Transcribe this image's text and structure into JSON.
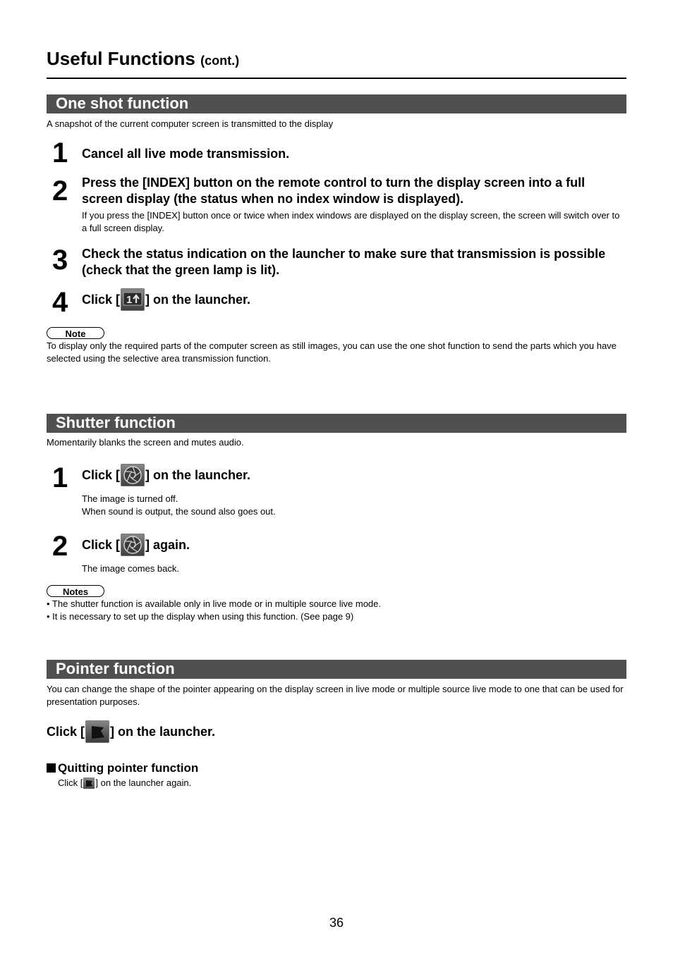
{
  "header": {
    "title": "Useful Functions",
    "title_suffix": "(cont.)"
  },
  "one_shot": {
    "heading": "One shot function",
    "intro": "A snapshot of the current computer screen is transmitted to the display",
    "steps": [
      {
        "number": "1",
        "text": "Cancel all live mode transmission."
      },
      {
        "number": "2",
        "text": "Press the [INDEX] button on the remote control to turn the display screen into a full screen display (the status when no index window is displayed).",
        "detail": "If you press the [INDEX] button once or twice when index windows are displayed on the display screen, the screen will switch over to a full screen display."
      },
      {
        "number": "3",
        "text": "Check the status indication on the launcher to make sure that transmission is possible (check that the green lamp is lit)."
      },
      {
        "number": "4",
        "text_before": "Click [",
        "text_after": "] on the launcher.",
        "icon": "one-shot-upload-icon"
      }
    ],
    "note_label": "Note",
    "note_text": "To display only the required parts of the computer screen as still images, you can use the one shot function to send the parts which you have selected using the selective area transmission function."
  },
  "shutter": {
    "heading": "Shutter function",
    "intro": "Momentarily blanks the screen and mutes audio.",
    "steps": [
      {
        "number": "1",
        "text_before": "Click [",
        "text_after": "] on the launcher.",
        "icon": "shutter-aperture-icon",
        "detail_lines": [
          "The image is turned off.",
          "When sound is output, the sound also goes out."
        ]
      },
      {
        "number": "2",
        "text_before": "Click [",
        "text_after": "] again.",
        "icon": "shutter-aperture-icon",
        "detail_lines": [
          "The image comes back."
        ]
      }
    ],
    "notes_label": "Notes",
    "notes": [
      "• The shutter function is available only in live mode or in multiple source live mode.",
      "• It is necessary to set up the display when using this function. (See page 9)"
    ]
  },
  "pointer": {
    "heading": "Pointer function",
    "intro": "You can change the shape of the pointer appearing on the display screen in live mode or multiple source live mode to one that can be used for presentation purposes.",
    "instruction_before": "Click [",
    "instruction_after": "] on the launcher.",
    "icon": "pointer-arrow-icon",
    "quit_heading": "Quitting pointer function",
    "quit_before": "Click [",
    "quit_after": "] on the launcher again."
  },
  "footer": {
    "page_number": "36"
  }
}
